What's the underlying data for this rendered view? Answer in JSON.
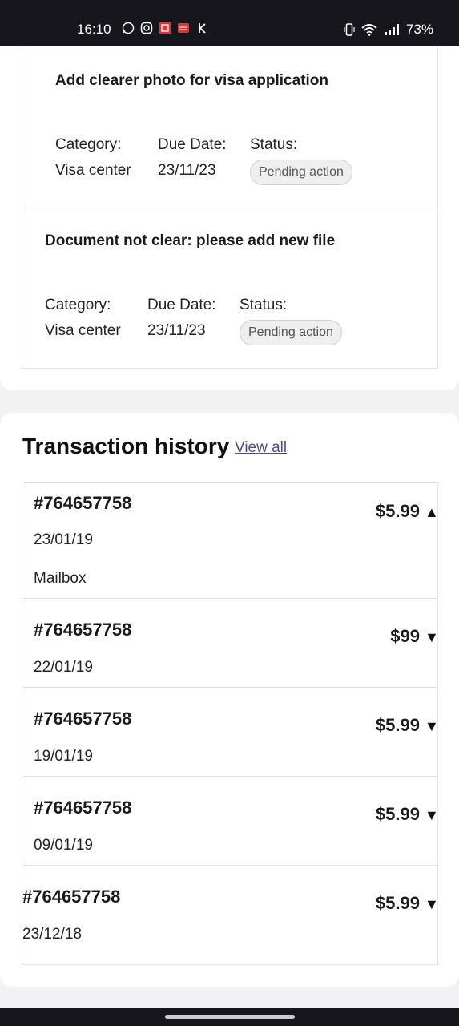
{
  "status_bar": {
    "time": "16:10",
    "battery": "73%",
    "app_icons": [
      "whatsapp-icon",
      "instagram-icon",
      "app-grid-icon",
      "bank-icon",
      "k-icon"
    ]
  },
  "tasks": [
    {
      "title": "Add clearer photo for visa application",
      "category_label": "Category:",
      "category_value": "Visa center",
      "due_label": "Due Date:",
      "due_value": "23/11/23",
      "status_label": "Status:",
      "status_value": "Pending action"
    },
    {
      "title": "Document not clear: please add new file",
      "category_label": "Category:",
      "category_value": "Visa center",
      "due_label": "Due Date:",
      "due_value": "23/11/23",
      "status_label": "Status:",
      "status_value": "Pending action"
    }
  ],
  "transactions": {
    "heading": "Transaction history",
    "view_all": "View all",
    "rows": [
      {
        "id": "#764657758",
        "date": "23/01/19",
        "description": "Mailbox",
        "amount": "$5.99",
        "expanded": true
      },
      {
        "id": "#764657758",
        "date": "22/01/19",
        "amount": "$99",
        "expanded": false
      },
      {
        "id": "#764657758",
        "date": "19/01/19",
        "amount": "$5.99",
        "expanded": false
      },
      {
        "id": "#764657758",
        "date": "09/01/19",
        "amount": "$5.99",
        "expanded": false
      },
      {
        "id": "#764657758",
        "date": "23/12/18",
        "amount": "$5.99",
        "expanded": false
      }
    ]
  },
  "colors": {
    "status_bar_bg": "#17161c",
    "badge_bg": "#efeff2",
    "link": "#4a4f8a"
  }
}
